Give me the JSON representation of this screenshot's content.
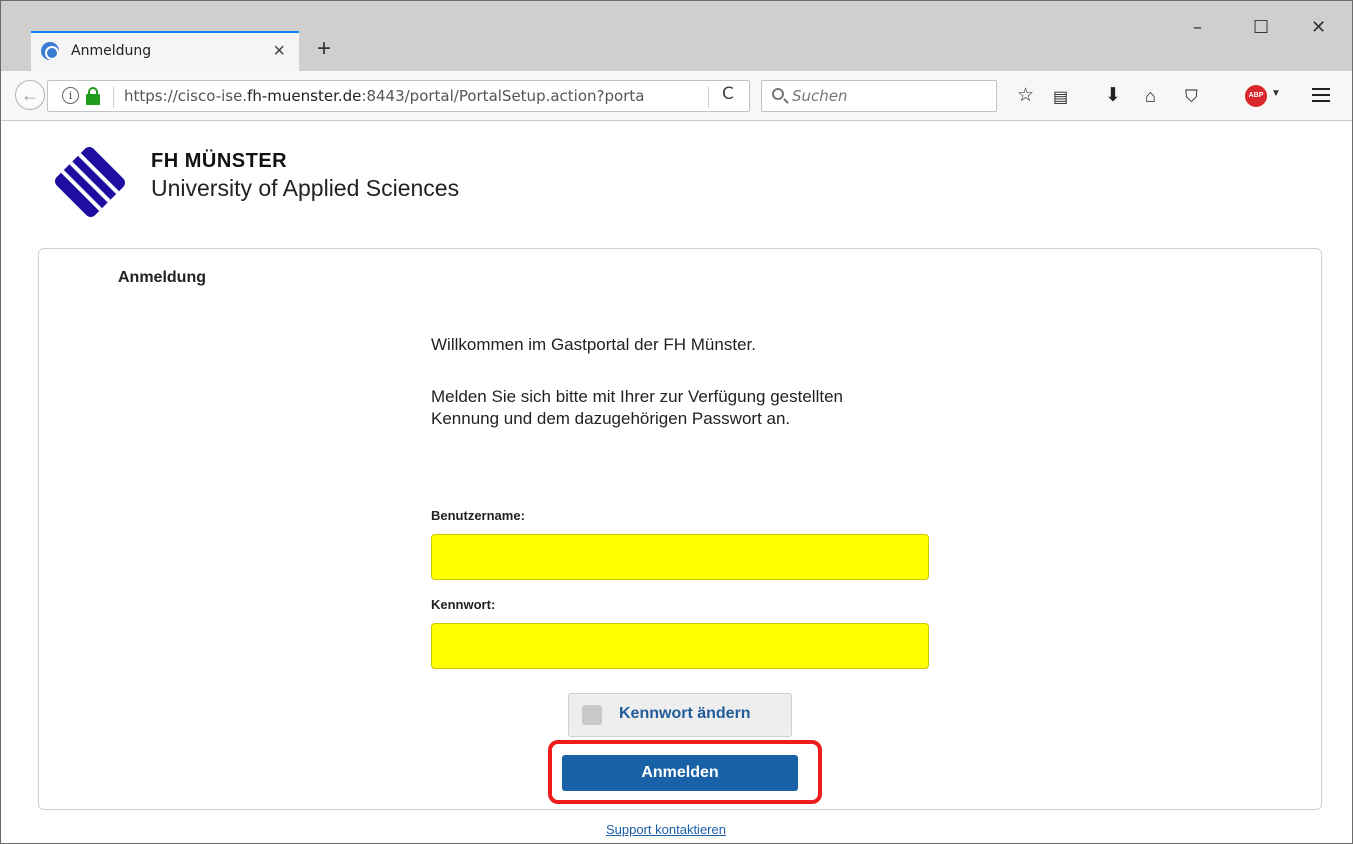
{
  "browser": {
    "tab_title": "Anmeldung",
    "tab_close": "×",
    "new_tab": "+",
    "window_controls": {
      "minimize": "–",
      "maximize": "☐",
      "close": "✕"
    },
    "back": "←",
    "info": "i",
    "url_prefix": "https://cisco-ise.",
    "url_domain": "fh-muenster.de",
    "url_rest": ":8443/portal/PortalSetup.action?porta",
    "reload": "C",
    "search_placeholder": "Suchen",
    "toolbar_icons": [
      "star-icon",
      "reader-icon",
      "download-icon",
      "home-icon",
      "pocket-icon",
      "adblock-icon",
      "menu-icon"
    ],
    "abp_label": "ABP",
    "accent_color": "#0a84ff"
  },
  "logo": {
    "line1": "FH MÜNSTER",
    "line2": "University of Applied Sciences",
    "color": "#1f0ca0"
  },
  "login": {
    "heading": "Anmeldung",
    "welcome": "Willkommen im Gastportal der FH Münster.",
    "instructions": "Melden Sie sich bitte mit Ihrer zur Verfügung gestellten Kennung und dem dazugehörigen Passwort an.",
    "username_label": "Benutzername:",
    "username_value": "",
    "password_label": "Kennwort:",
    "password_value": "",
    "change_password_label": "Kennwort ändern",
    "submit_label": "Anmelden",
    "support_link": "Support kontaktieren",
    "field_color": "#ffff00",
    "button_color": "#1a62a7",
    "highlight_color": "#ee1c1c"
  }
}
